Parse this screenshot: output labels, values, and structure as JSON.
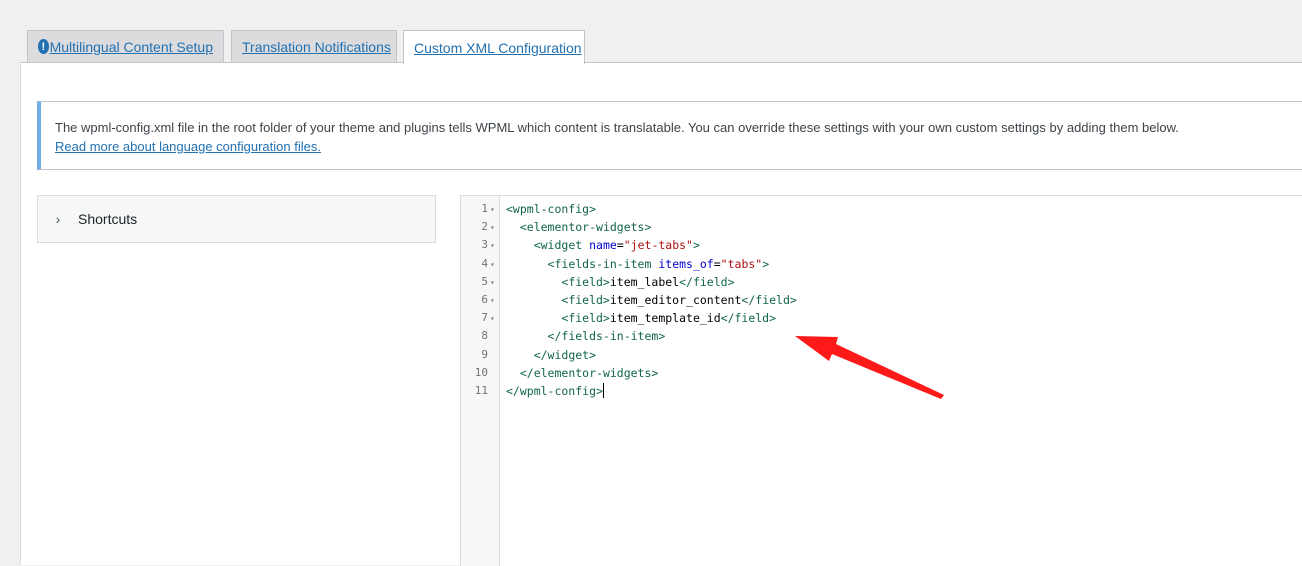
{
  "tabs": [
    {
      "label": "Multilingual Content Setup",
      "has_warning": true,
      "warning_glyph": "!"
    },
    {
      "label": "Translation Notifications"
    },
    {
      "label": "Custom XML Configuration",
      "active": true
    }
  ],
  "notice": {
    "text": "The wpml-config.xml file in the root folder of your theme and plugins tells WPML which content is translatable. You can override these settings with your own custom settings by adding them below.",
    "link_text": "Read more about language configuration files."
  },
  "shortcuts": {
    "label": "Shortcuts",
    "icon": "chevron-right-icon"
  },
  "editor": {
    "line_numbers": [
      "1",
      "2",
      "3",
      "4",
      "5",
      "6",
      "7",
      "8",
      "9",
      "10",
      "11"
    ],
    "fold_markers": [
      "▾",
      "▾",
      "▾",
      "▾",
      "▾",
      "▾",
      "▾",
      "",
      "",
      "",
      ""
    ],
    "lines": [
      [
        {
          "t": "<wpml-config>",
          "k": "tag"
        }
      ],
      [
        {
          "t": "  "
        },
        {
          "t": "<elementor-widgets>",
          "k": "tag"
        }
      ],
      [
        {
          "t": "    "
        },
        {
          "t": "<widget",
          "k": "tag"
        },
        {
          "t": " "
        },
        {
          "t": "name",
          "k": "attr"
        },
        {
          "t": "=",
          "k": "txt"
        },
        {
          "t": "\"jet-tabs\"",
          "k": "str"
        },
        {
          "t": ">",
          "k": "tag"
        }
      ],
      [
        {
          "t": "      "
        },
        {
          "t": "<fields-in-item",
          "k": "tag"
        },
        {
          "t": " "
        },
        {
          "t": "items_of",
          "k": "attr"
        },
        {
          "t": "=",
          "k": "txt"
        },
        {
          "t": "\"tabs\"",
          "k": "str"
        },
        {
          "t": ">",
          "k": "tag"
        }
      ],
      [
        {
          "t": "        "
        },
        {
          "t": "<field>",
          "k": "tag"
        },
        {
          "t": "item_label",
          "k": "txt"
        },
        {
          "t": "</field>",
          "k": "tag"
        }
      ],
      [
        {
          "t": "        "
        },
        {
          "t": "<field>",
          "k": "tag"
        },
        {
          "t": "item_editor_content",
          "k": "txt"
        },
        {
          "t": "</field>",
          "k": "tag"
        }
      ],
      [
        {
          "t": "        "
        },
        {
          "t": "<field>",
          "k": "tag"
        },
        {
          "t": "item_template_id",
          "k": "txt"
        },
        {
          "t": "</field>",
          "k": "tag"
        }
      ],
      [
        {
          "t": "      "
        },
        {
          "t": "</fields-in-item>",
          "k": "tag"
        }
      ],
      [
        {
          "t": "    "
        },
        {
          "t": "</widget>",
          "k": "tag"
        }
      ],
      [
        {
          "t": "  "
        },
        {
          "t": "</elementor-widgets>",
          "k": "tag"
        }
      ],
      [
        {
          "t": "</wpml-config>",
          "k": "tag"
        }
      ]
    ],
    "cursor_line": 11
  },
  "annotation": {
    "color": "#ff1a1a",
    "icon": "red-arrow-annotation"
  }
}
